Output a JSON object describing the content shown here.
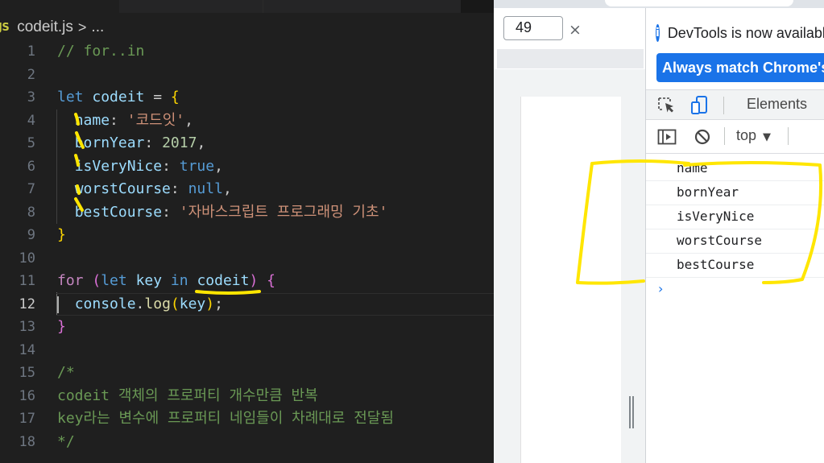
{
  "editor": {
    "breadcrumb": {
      "file_icon": "JS",
      "file": "codeit.js",
      "separator": ">",
      "more": "..."
    },
    "current_line": 12,
    "lines": [
      {
        "n": "1",
        "tokens": [
          {
            "t": "// for..in",
            "c": "c"
          }
        ]
      },
      {
        "n": "2",
        "tokens": []
      },
      {
        "n": "3",
        "tokens": [
          {
            "t": "let",
            "c": "k"
          },
          {
            "t": " ",
            "c": "p"
          },
          {
            "t": "codeit",
            "c": "v"
          },
          {
            "t": " = ",
            "c": "p"
          },
          {
            "t": "{",
            "c": "b1"
          }
        ]
      },
      {
        "n": "4",
        "tokens": [
          {
            "t": "  ",
            "c": "p"
          },
          {
            "t": "name",
            "c": "v"
          },
          {
            "t": ": ",
            "c": "p"
          },
          {
            "t": "'코드잇'",
            "c": "s"
          },
          {
            "t": ",",
            "c": "p"
          }
        ]
      },
      {
        "n": "5",
        "tokens": [
          {
            "t": "  ",
            "c": "p"
          },
          {
            "t": "bornYear",
            "c": "v"
          },
          {
            "t": ": ",
            "c": "p"
          },
          {
            "t": "2017",
            "c": "n"
          },
          {
            "t": ",",
            "c": "p"
          }
        ]
      },
      {
        "n": "6",
        "tokens": [
          {
            "t": "  ",
            "c": "p"
          },
          {
            "t": "isVeryNice",
            "c": "v"
          },
          {
            "t": ": ",
            "c": "p"
          },
          {
            "t": "true",
            "c": "k"
          },
          {
            "t": ",",
            "c": "p"
          }
        ]
      },
      {
        "n": "7",
        "tokens": [
          {
            "t": "  ",
            "c": "p"
          },
          {
            "t": "worstCourse",
            "c": "v"
          },
          {
            "t": ": ",
            "c": "p"
          },
          {
            "t": "null",
            "c": "k"
          },
          {
            "t": ",",
            "c": "p"
          }
        ]
      },
      {
        "n": "8",
        "tokens": [
          {
            "t": "  ",
            "c": "p"
          },
          {
            "t": "bestCourse",
            "c": "v"
          },
          {
            "t": ": ",
            "c": "p"
          },
          {
            "t": "'자바스크립트 프로그래밍 기초'",
            "c": "s"
          }
        ]
      },
      {
        "n": "9",
        "tokens": [
          {
            "t": "}",
            "c": "b1"
          }
        ]
      },
      {
        "n": "10",
        "tokens": []
      },
      {
        "n": "11",
        "tokens": [
          {
            "t": "for",
            "c": "kc"
          },
          {
            "t": " ",
            "c": "p"
          },
          {
            "t": "(",
            "c": "b2"
          },
          {
            "t": "let",
            "c": "k"
          },
          {
            "t": " ",
            "c": "p"
          },
          {
            "t": "key",
            "c": "v"
          },
          {
            "t": " ",
            "c": "p"
          },
          {
            "t": "in",
            "c": "k"
          },
          {
            "t": " ",
            "c": "p"
          },
          {
            "t": "codeit",
            "c": "v"
          },
          {
            "t": ")",
            "c": "b2"
          },
          {
            "t": " ",
            "c": "p"
          },
          {
            "t": "{",
            "c": "b2"
          }
        ]
      },
      {
        "n": "12",
        "tokens": [
          {
            "t": "  ",
            "c": "p"
          },
          {
            "t": "console",
            "c": "v"
          },
          {
            "t": ".",
            "c": "p"
          },
          {
            "t": "log",
            "c": "f"
          },
          {
            "t": "(",
            "c": "b1"
          },
          {
            "t": "key",
            "c": "v"
          },
          {
            "t": ")",
            "c": "b1"
          },
          {
            "t": ";",
            "c": "p"
          }
        ]
      },
      {
        "n": "13",
        "tokens": [
          {
            "t": "}",
            "c": "b2"
          }
        ]
      },
      {
        "n": "14",
        "tokens": []
      },
      {
        "n": "15",
        "tokens": [
          {
            "t": "/*",
            "c": "c"
          }
        ]
      },
      {
        "n": "16",
        "tokens": [
          {
            "t": "codeit 객체의 프로퍼티 개수만큼 반복",
            "c": "c"
          }
        ]
      },
      {
        "n": "17",
        "tokens": [
          {
            "t": "key라는 변수에 프로퍼티 네임들이 차례대로 전달됨",
            "c": "c"
          }
        ]
      },
      {
        "n": "18",
        "tokens": [
          {
            "t": "*/",
            "c": "c"
          }
        ]
      }
    ]
  },
  "browser": {
    "width_value": "49",
    "times_symbol": "×"
  },
  "devtools": {
    "info_text": "DevTools is now available in your language!",
    "match_button": "Always match Chrome's language",
    "elements_tab": "Elements",
    "context": "top",
    "console_logs": [
      "name",
      "bornYear",
      "isVeryNice",
      "worstCourse",
      "bestCourse"
    ],
    "prompt_symbol": "›"
  },
  "annotation_color": "#ffe600"
}
